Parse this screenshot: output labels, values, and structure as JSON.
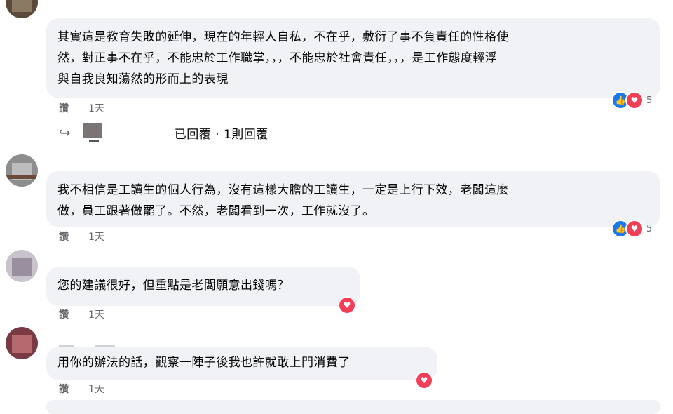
{
  "comments": [
    {
      "text_lines": [
        "其實這是教育失敗的延伸，現在的年輕人自私，不在乎，敷衍了事不負責任的性格使",
        "然，對正事不在乎，不能忠於工作職掌，，，不能忠於社會責任，，，是工作態度輕浮",
        "與自我良知蕩然的形而上的表現"
      ],
      "like_label": "讚",
      "time": "1天",
      "reaction_count": "5",
      "reactions": [
        "like-icon",
        "love-icon"
      ]
    },
    {
      "text_lines": [
        "我不相信是工讀生的個人行為，沒有這樣大膽的工讀生，一定是上行下效，老闆這麼",
        "做，員工跟著做罷了。不然，老闆看到一次，工作就沒了。"
      ],
      "like_label": "讚",
      "time": "1天",
      "reaction_count": "5",
      "reactions": [
        "like-icon",
        "love-icon"
      ]
    },
    {
      "text_lines": [
        "您的建議很好，但重點是老闆願意出錢嗎？"
      ],
      "like_label": "讚",
      "time": "1天",
      "reactions": [
        "love-icon"
      ]
    },
    {
      "text_lines": [
        "用你的辦法的話，觀察一陣子後我也許就敢上門消費了"
      ],
      "like_label": "讚",
      "time": "1天",
      "reactions": [
        "love-icon"
      ]
    }
  ],
  "reply_summary": "已回覆 · 1則回覆",
  "colors": {
    "bubble_bg": "#f0f2f5",
    "meta_text": "#65676b",
    "like_blue": "#1877f2",
    "love_red": "#f33e58"
  }
}
